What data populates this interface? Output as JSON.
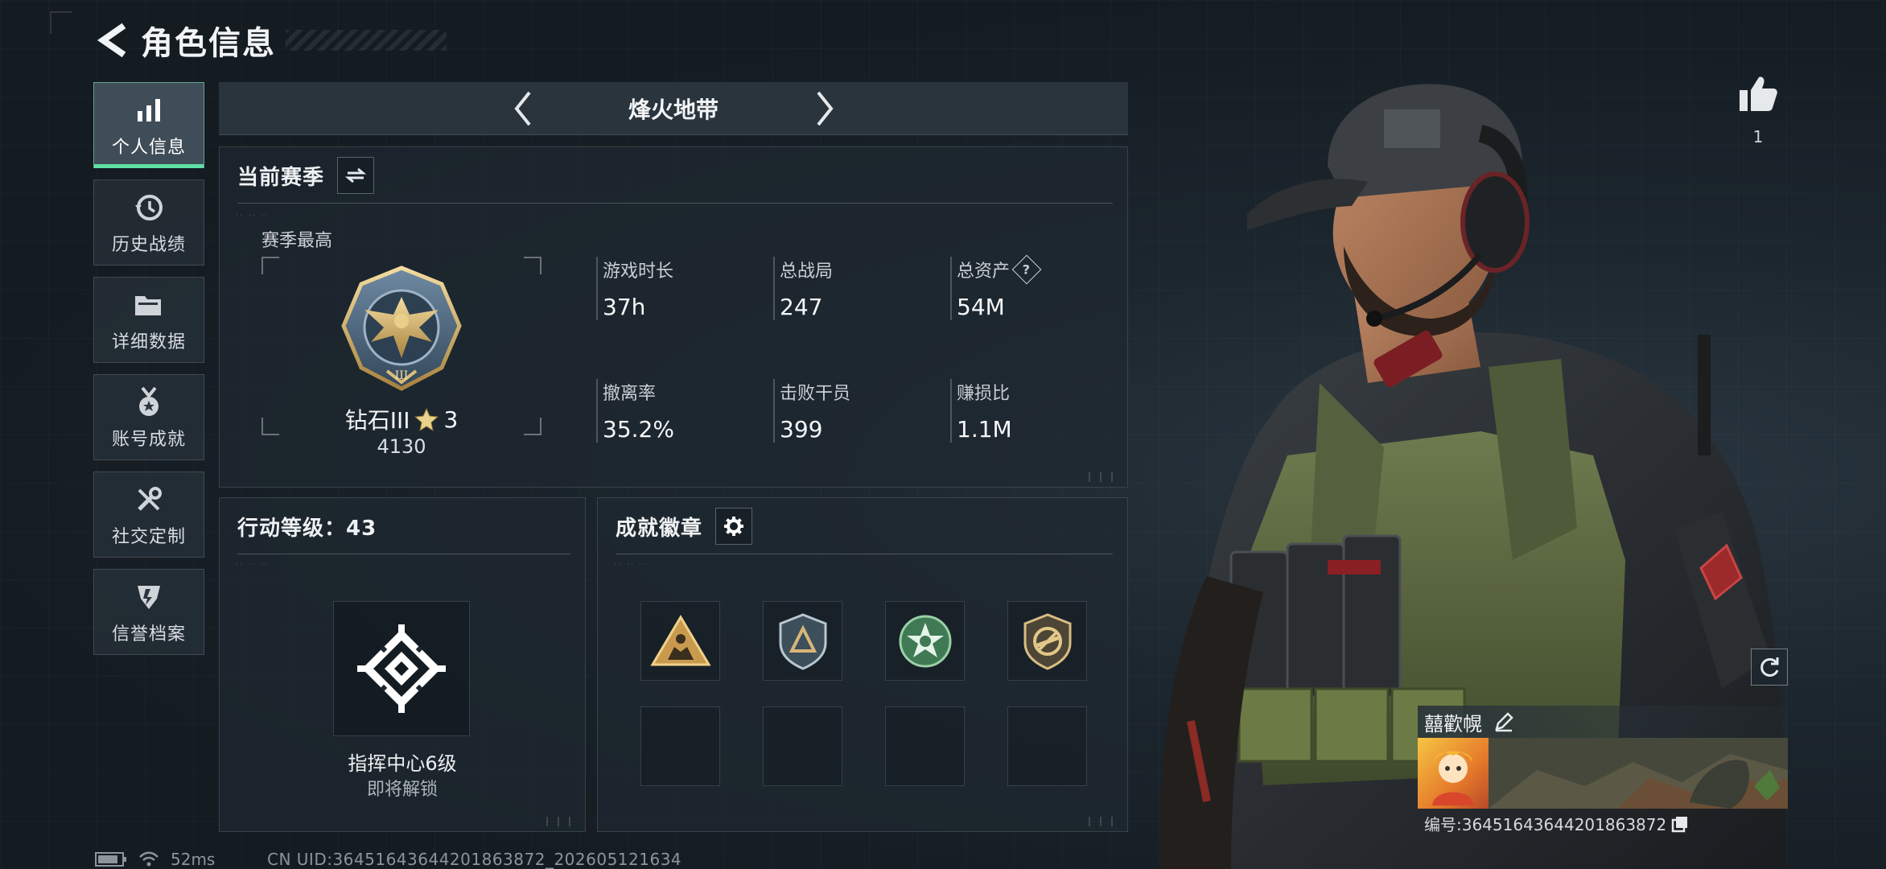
{
  "header": {
    "title": "角色信息"
  },
  "sidebar": {
    "items": [
      {
        "label": "个人信息",
        "icon": "bar-chart-icon",
        "active": true
      },
      {
        "label": "历史战绩",
        "icon": "history-clock-icon",
        "active": false
      },
      {
        "label": "详细数据",
        "icon": "folder-icon",
        "active": false
      },
      {
        "label": "账号成就",
        "icon": "medal-icon",
        "active": false
      },
      {
        "label": "社交定制",
        "icon": "wrench-icon",
        "active": false
      },
      {
        "label": "信誉档案",
        "icon": "credit-shield-icon",
        "active": false
      }
    ]
  },
  "mode": {
    "title": "烽火地带"
  },
  "season": {
    "title": "当前赛季",
    "best_label": "赛季最高",
    "rank": {
      "name": "钻石III",
      "stars": "3",
      "score": "4130"
    },
    "stats": [
      {
        "label": "游戏时长",
        "value": "37h"
      },
      {
        "label": "总战局",
        "value": "247"
      },
      {
        "label": "总资产",
        "value": "54M",
        "help": "?"
      },
      {
        "label": "撤离率",
        "value": "35.2%"
      },
      {
        "label": "击败干员",
        "value": "399"
      },
      {
        "label": "赚损比",
        "value": "1.1M"
      }
    ]
  },
  "level": {
    "title": "行动等级：43",
    "facility": "指挥中心6级",
    "status": "即将解锁"
  },
  "badges": {
    "title": "成就徽章",
    "slots": [
      {
        "icon": "triangle-squad-badge",
        "filled": true
      },
      {
        "icon": "shield-triangle-badge",
        "filled": true
      },
      {
        "icon": "green-star-badge",
        "filled": true
      },
      {
        "icon": "no-rifle-badge",
        "filled": true
      },
      {
        "filled": false
      },
      {
        "filled": false
      },
      {
        "filled": false
      },
      {
        "filled": false
      }
    ]
  },
  "profile": {
    "likes": "1",
    "name": "囍歡幌",
    "uid_line": "编号:3645164364420186387​2"
  },
  "status_bar": {
    "ping": "52ms",
    "cn_uid": "CN UID:3645164364420186387​2_202605121634"
  },
  "colors": {
    "accent_green": "#5fe0a5",
    "panel_bg": "#1e2830"
  }
}
